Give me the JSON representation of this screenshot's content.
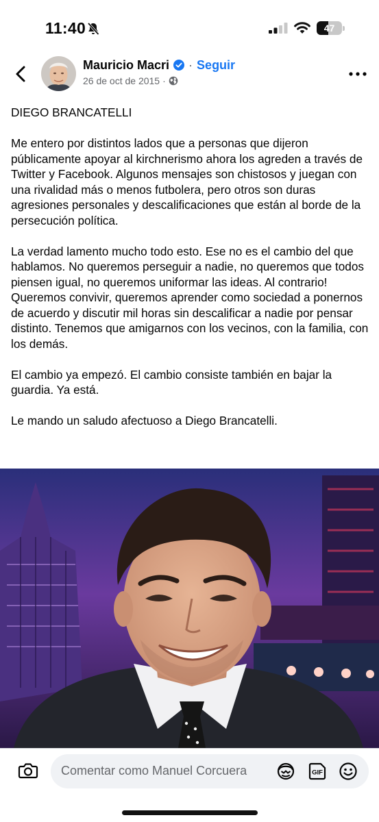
{
  "status_bar": {
    "time": "11:40",
    "battery_level": "47",
    "battery_fraction": 0.47,
    "icons": [
      "bell-slash-icon",
      "cellular-signal-icon",
      "wifi-icon",
      "battery-icon"
    ]
  },
  "header": {
    "author": "Mauricio Macri",
    "separator": "·",
    "follow_label": "Seguir",
    "date": "26 de oct de 2015",
    "meta_separator": "·",
    "icons": [
      "back-arrow-icon",
      "verified-badge-icon",
      "globe-icon",
      "more-options-icon"
    ]
  },
  "post": {
    "paragraphs": [
      "DIEGO BRANCATELLI",
      "Me entero por distintos lados que a personas que dijeron públicamente apoyar al kirchnerismo ahora los agreden a través de Twitter y Facebook. Algunos mensajes son chistosos y juegan con una rivalidad más o menos futbolera, pero otros son duras agresiones personales y descalificaciones que están al borde de la persecución política.",
      "La verdad lamento mucho todo esto. Ese no es el cambio del que hablamos. No queremos perseguir a nadie, no queremos que todos piensen igual, no queremos uniformar las ideas. Al contrario! Queremos convivir, queremos aprender como sociedad a ponernos de acuerdo y discutir mil horas sin descalificar a nadie por pensar distinto. Tenemos que amigarnos con los vecinos, con la familia, con los demás.",
      "El cambio ya empezó. El cambio consiste también en bajar la guardia. Ya está.",
      "Le mando un saludo afectuoso a Diego Brancatelli."
    ]
  },
  "comment_bar": {
    "placeholder": "Comentar como Manuel Corcuera",
    "icons": [
      "camera-icon",
      "avatar-sticker-icon",
      "gif-icon",
      "emoji-icon"
    ]
  },
  "colors": {
    "accent": "#1877f2",
    "text": "#050505",
    "secondary_text": "#65676b",
    "input_bg": "#f0f2f5"
  }
}
